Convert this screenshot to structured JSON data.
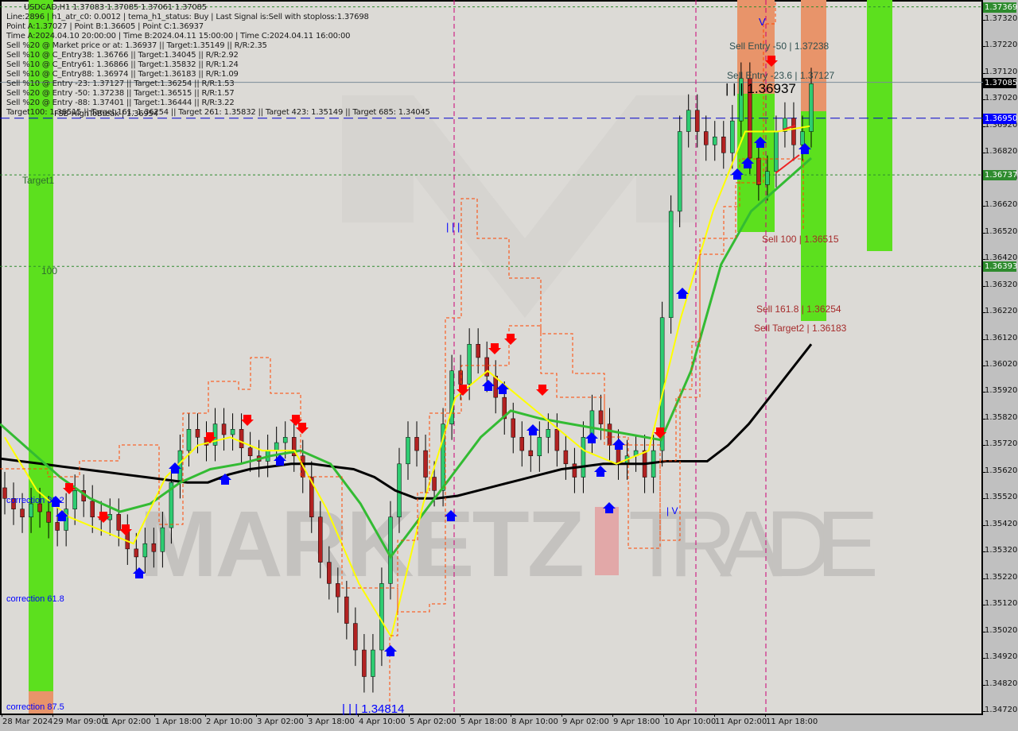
{
  "header": {
    "symbol_line": "USDCAD,H1  1.37083 1.37085 1.37061 1.37085",
    "info_lines": [
      "Line:2896 | h1_atr_c0: 0.0012 | tema_h1_status: Buy | Last Signal is:Sell with stoploss:1.37698",
      "Point A:1.37027 | Point B:1.36605 | Point C:1.36937",
      "Time A:2024.04.10 20:00:00 | Time B:2024.04.11 15:00:00 | Time C:2024.04.11 16:00:00",
      "Sell %20 @ Market price or at: 1.36937 || Target:1.35149 || R/R:2.35",
      "Sell %10 @ C_Entry38: 1.36766 || Target:1.34045 || R/R:2.92",
      "Sell %10 @ C_Entry61: 1.36866 || Target:1.35832 || R/R:1.24",
      "Sell %10 @ C_Entry88: 1.36974 || Target:1.36183 || R/R:1.09",
      "Sell %10 @ Entry -23: 1.37127 || Target:1.36254 || R/R:1.53",
      "Sell %20 @ Entry -50: 1.37238 || Target:1.36515 || R/R:1.57",
      "Sell %20 @ Entry -88: 1.37401 || Target:1.36444 || R/R:3.22",
      "Target100: 1.36515 || Target 161: 1.36254 || Target 261: 1.35832 || Target 423: 1.35149 || Target 685: 1.34045"
    ],
    "overlay_label": "FSB-HighToBreak | 1.36954"
  },
  "chart_data": {
    "type": "candlestick",
    "symbol": "USDCAD",
    "timeframe": "H1",
    "ohlc_last": {
      "open": 1.37083,
      "high": 1.37085,
      "low": 1.37061,
      "close": 1.37085
    },
    "ylim": [
      1.3469,
      1.374
    ],
    "y_ticks": [
      "1.37320",
      "1.37220",
      "1.37120",
      "1.37020",
      "1.36920",
      "1.36820",
      "1.36720",
      "1.36620",
      "1.36520",
      "1.36420",
      "1.36320",
      "1.36220",
      "1.36120",
      "1.36020",
      "1.35920",
      "1.35820",
      "1.35720",
      "1.35620",
      "1.35520",
      "1.35420",
      "1.35320",
      "1.35220",
      "1.35120",
      "1.35020",
      "1.34920",
      "1.34820",
      "1.34720"
    ],
    "x_ticks": [
      "28 Mar 2024",
      "29 Mar 09:00",
      "1 Apr 02:00",
      "1 Apr 18:00",
      "2 Apr 10:00",
      "3 Apr 02:00",
      "3 Apr 18:00",
      "4 Apr 10:00",
      "5 Apr 02:00",
      "5 Apr 18:00",
      "8 Apr 10:00",
      "9 Apr 02:00",
      "9 Apr 18:00",
      "10 Apr 10:00",
      "11 Apr 02:00",
      "11 Apr 18:00"
    ],
    "price_tags": [
      {
        "value": "1.37369",
        "color": "#2e8b2e"
      },
      {
        "value": "1.37085",
        "color": "#000000"
      },
      {
        "value": "1.36950",
        "color": "#0000ff"
      },
      {
        "value": "1.36737",
        "color": "#2e8b2e"
      },
      {
        "value": "1.36393",
        "color": "#2e8b2e"
      }
    ],
    "horizontal_levels": [
      {
        "name": "top-target",
        "price": 1.37369,
        "style": "dotted",
        "color": "#2e8b2e"
      },
      {
        "name": "current-price",
        "price": 1.37085,
        "style": "solid",
        "color": "#7a8a99"
      },
      {
        "name": "fsb-high",
        "price": 1.3695,
        "style": "dashed",
        "color": "#0000cc"
      },
      {
        "name": "target1",
        "price": 1.36737,
        "style": "dotted",
        "color": "#2e8b2e"
      },
      {
        "name": "level-100",
        "price": 1.36393,
        "style": "dotted",
        "color": "#2e8b2e"
      }
    ],
    "annotations": [
      {
        "text": "Sell Entry -50 | 1.37238",
        "color": "#2f4f4f"
      },
      {
        "text": "Sell Entry -23.6 | 1.37127",
        "color": "#2f4f4f"
      },
      {
        "text": "| | | 1.36937",
        "color": "#000000"
      },
      {
        "text": "Sell 100 | 1.36515",
        "color": "#a52a2a"
      },
      {
        "text": "Sell 161.8 | 1.36254",
        "color": "#a52a2a"
      },
      {
        "text": "Sell Target2 | 1.36183",
        "color": "#a52a2a"
      },
      {
        "text": "| | | 1.34814",
        "color": "#0000ff"
      },
      {
        "text": "Target1",
        "color": "#2e6b2e"
      },
      {
        "text": "100",
        "color": "#2e6b2e"
      },
      {
        "text": "correction 38.2",
        "color": "#0000ff"
      },
      {
        "text": "correction 61.8",
        "color": "#0000ff"
      },
      {
        "text": "correction 87.5",
        "color": "#0000ff"
      },
      {
        "text": "V",
        "color": "#0000ff"
      },
      {
        "text": "| V",
        "color": "#0000ff"
      },
      {
        "text": "| | |",
        "color": "#0000ff"
      }
    ],
    "series": [
      {
        "name": "price-close",
        "color": "#000000",
        "values": [
          1.3552,
          1.3548,
          1.3545,
          1.355,
          1.3547,
          1.3543,
          1.354,
          1.3548,
          1.3555,
          1.3551,
          1.3545,
          1.3544,
          1.3546,
          1.354,
          1.3533,
          1.353,
          1.3535,
          1.3532,
          1.3541,
          1.3558,
          1.357,
          1.3578,
          1.3575,
          1.3572,
          1.358,
          1.3576,
          1.3578,
          1.3571,
          1.3568,
          1.3566,
          1.357,
          1.3573,
          1.3575,
          1.3568,
          1.356,
          1.3545,
          1.3528,
          1.352,
          1.3515,
          1.3505,
          1.3495,
          1.3485,
          1.3495,
          1.352,
          1.3545,
          1.3565,
          1.3575,
          1.357,
          1.356,
          1.3555,
          1.358,
          1.36,
          1.3595,
          1.361,
          1.3605,
          1.3598,
          1.359,
          1.3582,
          1.3575,
          1.357,
          1.3568,
          1.3575,
          1.3578,
          1.357,
          1.3565,
          1.356,
          1.3575,
          1.3585,
          1.358,
          1.3572,
          1.3565,
          1.3568,
          1.357,
          1.356,
          1.357,
          1.362,
          1.366,
          1.369,
          1.3698,
          1.369,
          1.3685,
          1.3688,
          1.3682,
          1.3694,
          1.371,
          1.368,
          1.367,
          1.3675,
          1.369,
          1.3695,
          1.3685,
          1.369,
          1.3708
        ]
      },
      {
        "name": "ma-black",
        "color": "#000000",
        "values": [
          1.3567,
          1.3566,
          1.3565,
          1.3564,
          1.3563,
          1.3562,
          1.3561,
          1.356,
          1.3559,
          1.3558,
          1.3558,
          1.3561,
          1.3563,
          1.3564,
          1.3565,
          1.3565,
          1.3564,
          1.3563,
          1.356,
          1.3555,
          1.3552,
          1.3552,
          1.3553,
          1.3555,
          1.3557,
          1.3559,
          1.3561,
          1.3563,
          1.3564,
          1.3565,
          1.3565,
          1.3565,
          1.3566,
          1.3566,
          1.3566,
          1.3572,
          1.358,
          1.359,
          1.36,
          1.361
        ]
      },
      {
        "name": "ma-green",
        "color": "#33bb33",
        "values": [
          1.358,
          1.357,
          1.356,
          1.3552,
          1.3547,
          1.355,
          1.3558,
          1.3563,
          1.3565,
          1.3568,
          1.357,
          1.3565,
          1.355,
          1.353,
          1.3545,
          1.356,
          1.3575,
          1.3585,
          1.3582,
          1.358,
          1.3578,
          1.3576,
          1.3574,
          1.36,
          1.364,
          1.366,
          1.367,
          1.368
        ]
      },
      {
        "name": "ma-yellow",
        "color": "#ffff00",
        "values": [
          1.3575,
          1.3555,
          1.3545,
          1.354,
          1.3535,
          1.356,
          1.3572,
          1.3575,
          1.357,
          1.357,
          1.3548,
          1.352,
          1.35,
          1.355,
          1.359,
          1.36,
          1.359,
          1.358,
          1.357,
          1.3565,
          1.357,
          1.362,
          1.366,
          1.369,
          1.369,
          1.3692
        ]
      }
    ]
  },
  "watermark": {
    "left": "MARKETZ",
    "right": "TRADE"
  },
  "colors": {
    "background": "#dcdad6",
    "bull_candle": "#2ecc71",
    "bear_candle": "#b22222",
    "zone_green": "#5ce01e",
    "zone_orange": "#e8946a",
    "signal_up": "#0000ff",
    "signal_down": "#ff0000",
    "vline_magenta": "#cc0077",
    "orange_dashed": "#ff4500"
  }
}
